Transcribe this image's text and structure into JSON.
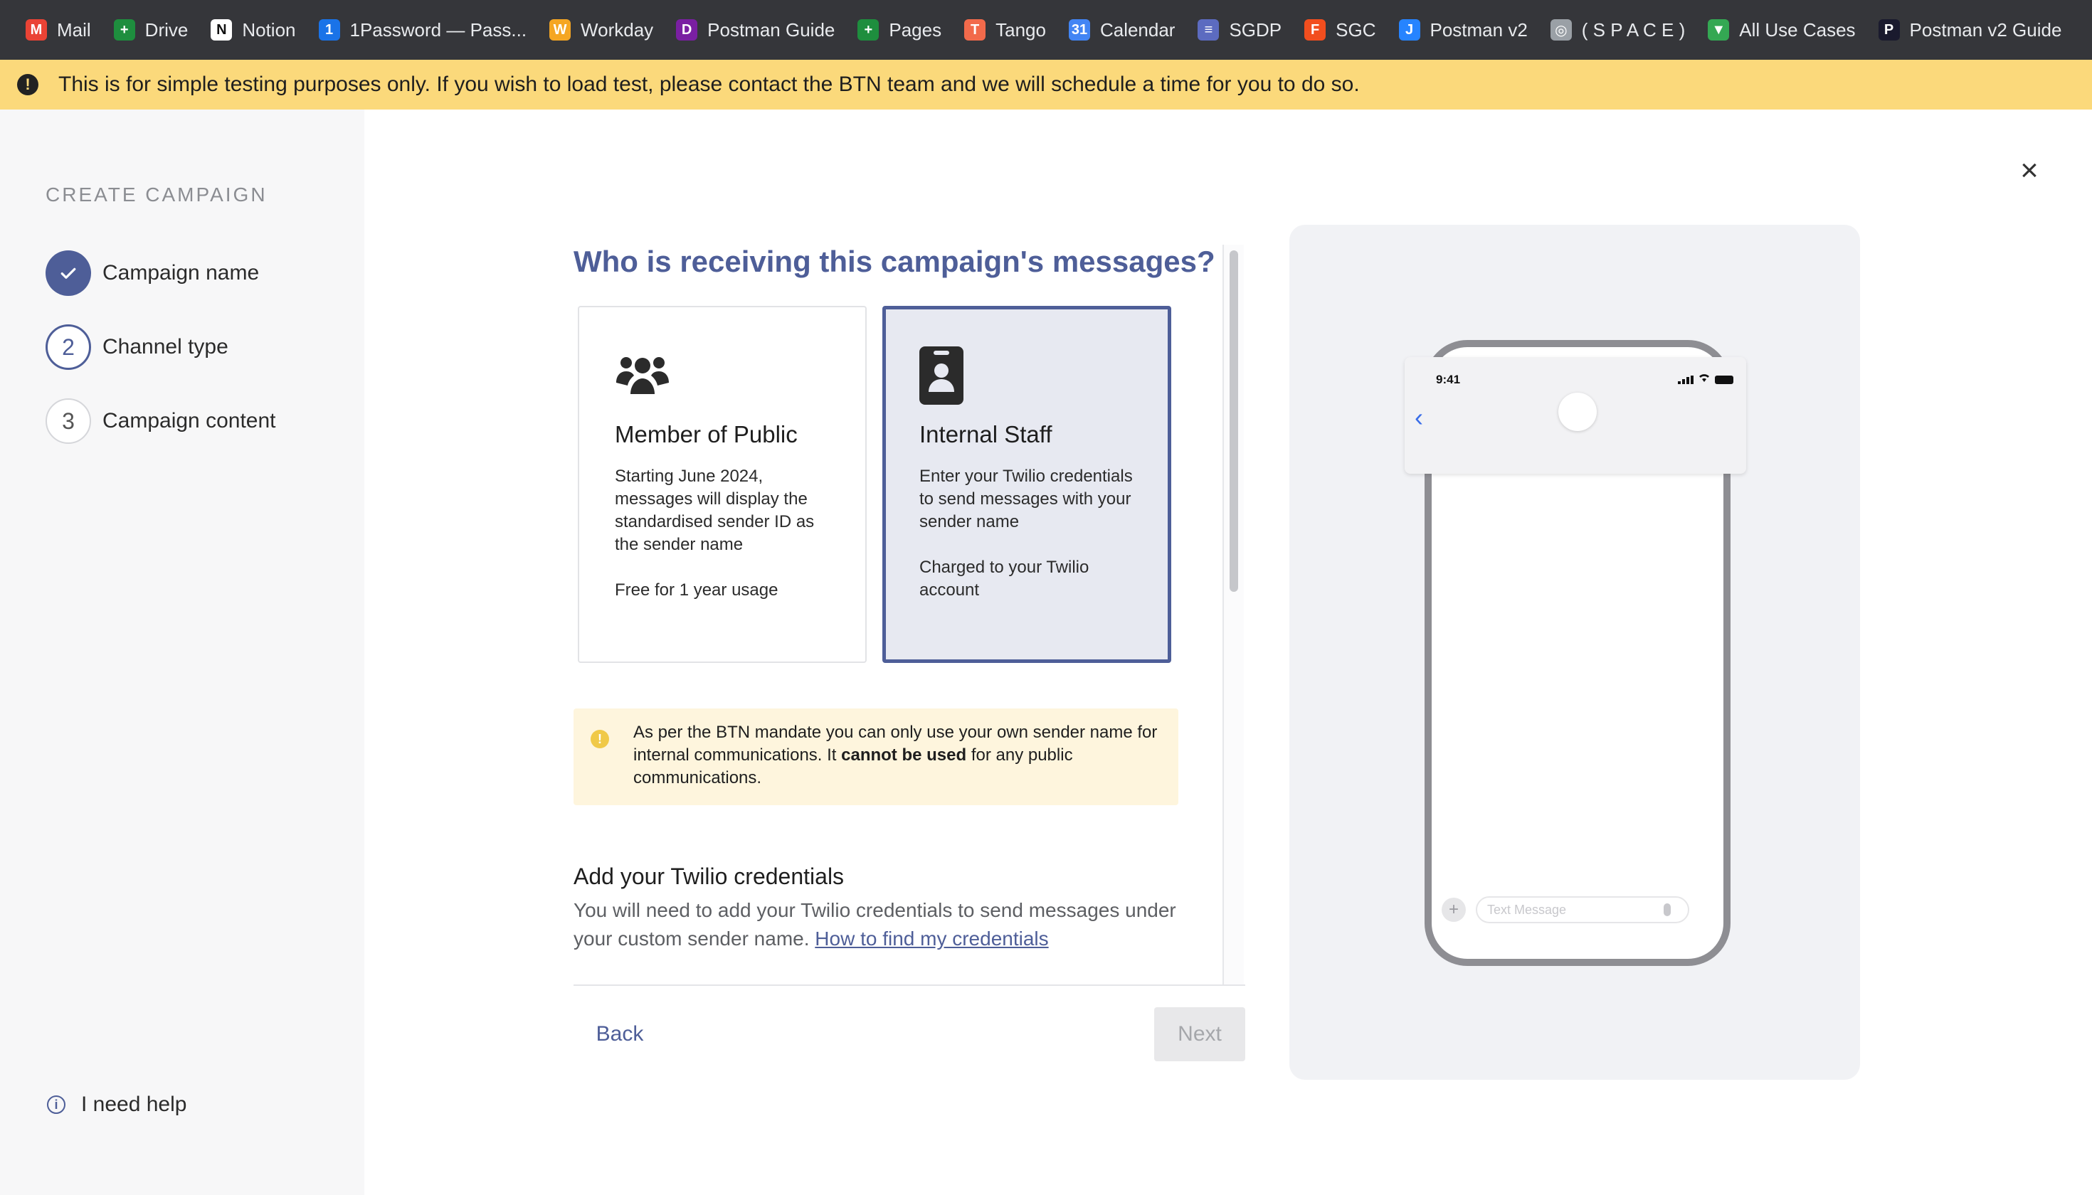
{
  "bookmarks": [
    {
      "label": "Mail",
      "icon": "gmail-icon",
      "color": "#ea4335",
      "glyph": "M"
    },
    {
      "label": "Drive",
      "icon": "sheets-icon",
      "color": "#1e8e3e",
      "glyph": "+"
    },
    {
      "label": "Notion",
      "icon": "notion-icon",
      "color": "#ffffff",
      "glyph": "N"
    },
    {
      "label": "1Password — Pass...",
      "icon": "onepassword-icon",
      "color": "#1a73e8",
      "glyph": "1"
    },
    {
      "label": "Workday",
      "icon": "workday-icon",
      "color": "#f5a623",
      "glyph": "W"
    },
    {
      "label": "Postman Guide",
      "icon": "postman-guide-icon",
      "color": "#7a1fa2",
      "glyph": "D"
    },
    {
      "label": "Pages",
      "icon": "pages-icon",
      "color": "#1e8e3e",
      "glyph": "+"
    },
    {
      "label": "Tango",
      "icon": "tango-icon",
      "color": "#f26a4b",
      "glyph": "T"
    },
    {
      "label": "Calendar",
      "icon": "calendar-icon",
      "color": "#4285f4",
      "glyph": "31"
    },
    {
      "label": "SGDP",
      "icon": "sgdp-icon",
      "color": "#5c6bc0",
      "glyph": "≡"
    },
    {
      "label": "SGC",
      "icon": "figma-icon",
      "color": "#f24e1e",
      "glyph": "F"
    },
    {
      "label": "Postman v2",
      "icon": "jira-icon",
      "color": "#2684ff",
      "glyph": "J"
    },
    {
      "label": "( S P A C E )",
      "icon": "planet-icon",
      "color": "#9aa0a6",
      "glyph": "◎"
    },
    {
      "label": "All Use Cases",
      "icon": "funnel-icon",
      "color": "#34a853",
      "glyph": "▼"
    },
    {
      "label": "Postman v2 Guide",
      "icon": "postman-v2-guide-icon",
      "color": "#1a1a2e",
      "glyph": "P"
    }
  ],
  "banner": {
    "text": "This is for simple testing purposes only. If you wish to load test, please contact the BTN team and we will schedule a time for you to do so."
  },
  "sidebar": {
    "heading": "CREATE CAMPAIGN",
    "steps": [
      {
        "number": "",
        "label": "Campaign name",
        "state": "done"
      },
      {
        "number": "2",
        "label": "Channel type",
        "state": "active"
      },
      {
        "number": "3",
        "label": "Campaign content",
        "state": "todo"
      }
    ],
    "help": "I need help"
  },
  "form": {
    "question": "Who is receiving this campaign's messages?",
    "options": [
      {
        "title": "Member of Public",
        "description": "Starting June 2024, messages will display the standardised sender ID as the sender name",
        "note": "Free for 1 year usage",
        "selected": false,
        "icon": "people-group-icon"
      },
      {
        "title": "Internal Staff",
        "description": "Enter your Twilio credentials to send messages with your sender name",
        "note": "Charged to your Twilio account",
        "selected": true,
        "icon": "id-badge-icon"
      }
    ],
    "notice": {
      "before": "As per the BTN mandate you can only use your own sender name for internal communications. It ",
      "bold": "cannot be used",
      "after": " for any public communications."
    },
    "credentials": {
      "title": "Add your Twilio credentials",
      "description": "You will need to add your Twilio credentials to send messages under your custom sender name. ",
      "link": "How to find my credentials"
    },
    "back_label": "Back",
    "next_label": "Next"
  },
  "preview": {
    "time": "9:41",
    "input_placeholder": "Text Message"
  },
  "colors": {
    "accent": "#4e5e98",
    "banner": "#fbd97b",
    "notice": "#fef5dd"
  }
}
